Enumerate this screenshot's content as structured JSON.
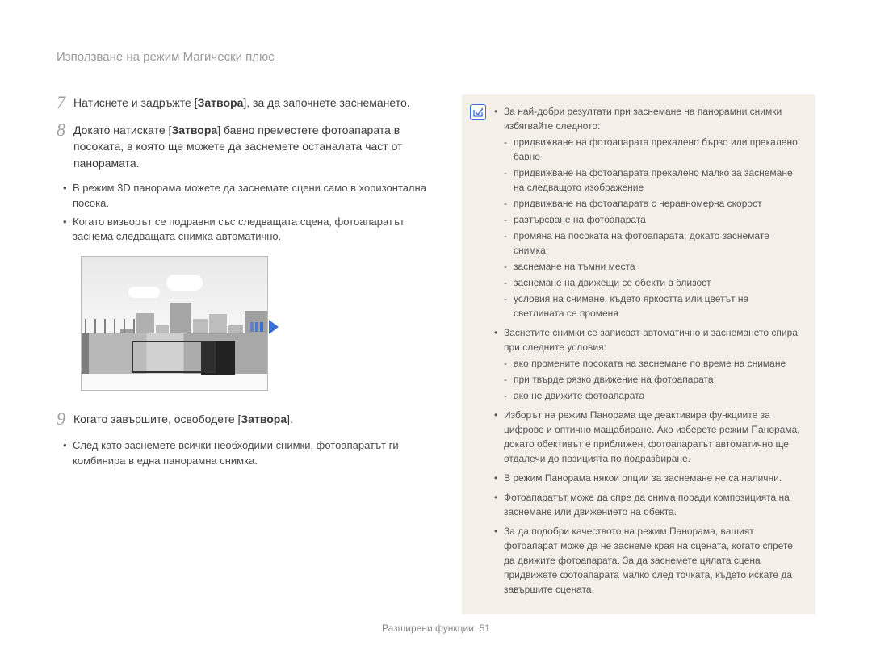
{
  "header": {
    "title": "Използване на режим Магически плюс"
  },
  "steps": {
    "s7": {
      "num": "7",
      "pre": "Натиснете и задръжте [",
      "bold": "Затвора",
      "post": "], за да започнете заснемането."
    },
    "s8": {
      "num": "8",
      "pre": "Докато натискате [",
      "bold": "Затвора",
      "post": "] бавно преместете фотоапарата в посоката, в която ще можете да заснемете останалата част от панорамата.",
      "sub": [
        "В режим 3D панорама можете да заснемате сцени само в хоризонтална посока.",
        "Когато визьорът се подравни със следващата сцена, фотоапаратът заснема следващата снимка автоматично."
      ]
    },
    "s9": {
      "num": "9",
      "pre": "Когато завършите, освободете [",
      "bold": "Затвора",
      "post": "].",
      "sub": [
        "След като заснемете всички необходими снимки, фотоапаратът ги комбинира в една панорамна снимка."
      ]
    }
  },
  "note": {
    "icon": "✓",
    "items": [
      {
        "text": "За най-добри резултати при заснемане на панорамни снимки избягвайте следното:",
        "sub": [
          "придвижване на фотоапарата прекалено бързо или прекалено бавно",
          "придвижване на фотоапарата прекалено малко за заснемане на следващото изображение",
          "придвижване на фотоапарата с неравномерна скорост",
          "разтърсване на фотоапарата",
          "промяна на посоката на фотоапарата, докато заснемате снимка",
          "заснемане на тъмни места",
          "заснемане на движещи се обекти в близост",
          "условия на снимане, където яркостта или цветът на светлината се променя"
        ]
      },
      {
        "text": "Заснетите снимки се записват автоматично и заснемането спира при следните условия:",
        "sub": [
          "ако промените посоката на заснемане по време на снимане",
          "при твърде рязко движение на фотоапарата",
          "ако не движите фотоапарата"
        ]
      },
      {
        "text": "Изборът на режим Панорама ще деактивира функциите за цифрово и оптично мащабиране. Ако изберете режим Панорама, докато обективът е приближен, фотоапаратът автоматично ще отдалечи до позицията по подразбиране."
      },
      {
        "text": "В режим Панорама някои опции за заснемане не са налични."
      },
      {
        "text": "Фотоапаратът може да спре да снима поради композицията на заснемане или движението на обекта."
      },
      {
        "text": "За да подобри качеството на режим Панорама, вашият фотоапарат може да не заснеме края на сцената, когато спрете да движите фотоапарата. За да заснемете цялата сцена придвижете фотоапарата малко след точката, където искате да завършите сцената."
      }
    ]
  },
  "footer": {
    "section": "Разширени функции",
    "page": "51"
  }
}
